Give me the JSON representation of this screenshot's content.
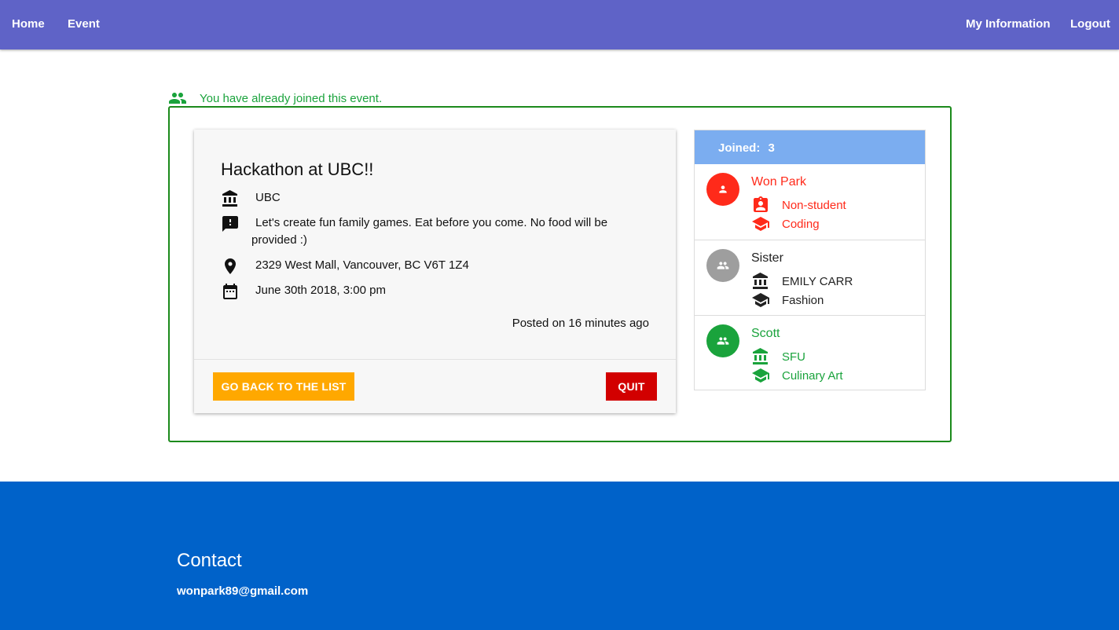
{
  "nav": {
    "home": "Home",
    "event": "Event",
    "my_information": "My Information",
    "logout": "Logout"
  },
  "notice": {
    "text": "You have already joined this event.",
    "icon": "group-icon",
    "color": "#1aa33c"
  },
  "event": {
    "title": "Hackathon at UBC!!",
    "location_name": "UBC",
    "description": "Let's create fun family games. Eat before you come. No food will be provided :)",
    "address": "2329 West Mall, Vancouver, BC V6T 1Z4",
    "datetime": "June 30th 2018, 3:00 pm",
    "posted": "Posted on 16 minutes ago",
    "back_button": "GO BACK TO THE LIST",
    "quit_button": "QUIT"
  },
  "members": {
    "header_label": "Joined:",
    "count": "3",
    "list": [
      {
        "name": "Won Park",
        "line1": "Non-student",
        "line2": "Coding",
        "color": "#ff2a1a",
        "avatar_color": "#ff2a1a",
        "avatar_icon": "person-icon",
        "line1_icon": "badge-icon"
      },
      {
        "name": "Sister",
        "line1": "EMILY CARR",
        "line2": "Fashion",
        "color": "#222222",
        "avatar_color": "#9e9e9e",
        "avatar_icon": "group-icon",
        "line1_icon": "institution-icon"
      },
      {
        "name": "Scott",
        "line1": "SFU",
        "line2": "Culinary Art",
        "color": "#1aa33c",
        "avatar_color": "#1aa33c",
        "avatar_icon": "group-icon",
        "line1_icon": "institution-icon"
      }
    ]
  },
  "footer": {
    "title": "Contact",
    "email": "wonpark89@gmail.com"
  },
  "colors": {
    "navbar": "#5f63c7",
    "footer": "#0062c9",
    "back_button": "#ffa800",
    "quit_button": "#d20000",
    "panel_header": "#7badf0"
  }
}
